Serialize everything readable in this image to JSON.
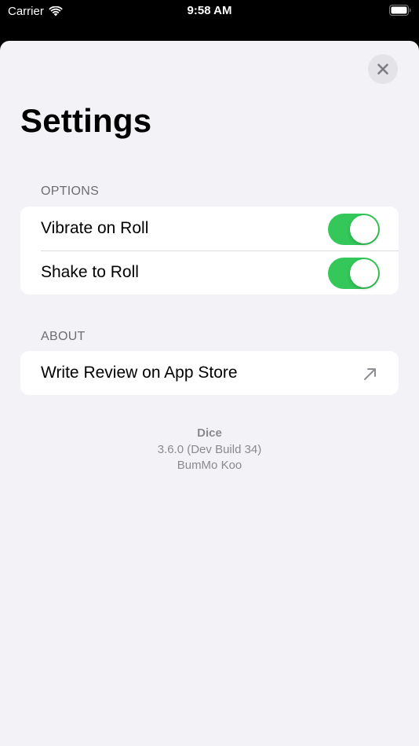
{
  "status_bar": {
    "carrier": "Carrier",
    "time": "9:58 AM",
    "icons": [
      "wifi-icon",
      "battery-icon"
    ]
  },
  "sheet": {
    "title": "Settings",
    "close_icon": "close-icon",
    "sections": [
      {
        "header": "OPTIONS",
        "rows": [
          {
            "label": "Vibrate on Roll",
            "control": "toggle",
            "on": true
          },
          {
            "label": "Shake to Roll",
            "control": "toggle",
            "on": true
          }
        ]
      },
      {
        "header": "ABOUT",
        "rows": [
          {
            "label": "Write Review on App Store",
            "control": "external-link-arrow-icon"
          }
        ]
      }
    ],
    "footer": {
      "app_name": "Dice",
      "version": "3.6.0 (Dev Build 34)",
      "author": "BumMo Koo"
    }
  },
  "colors": {
    "toggle_on": "#34c759",
    "background": "#f2f2f7",
    "secondary_text": "#8a8a8e"
  }
}
